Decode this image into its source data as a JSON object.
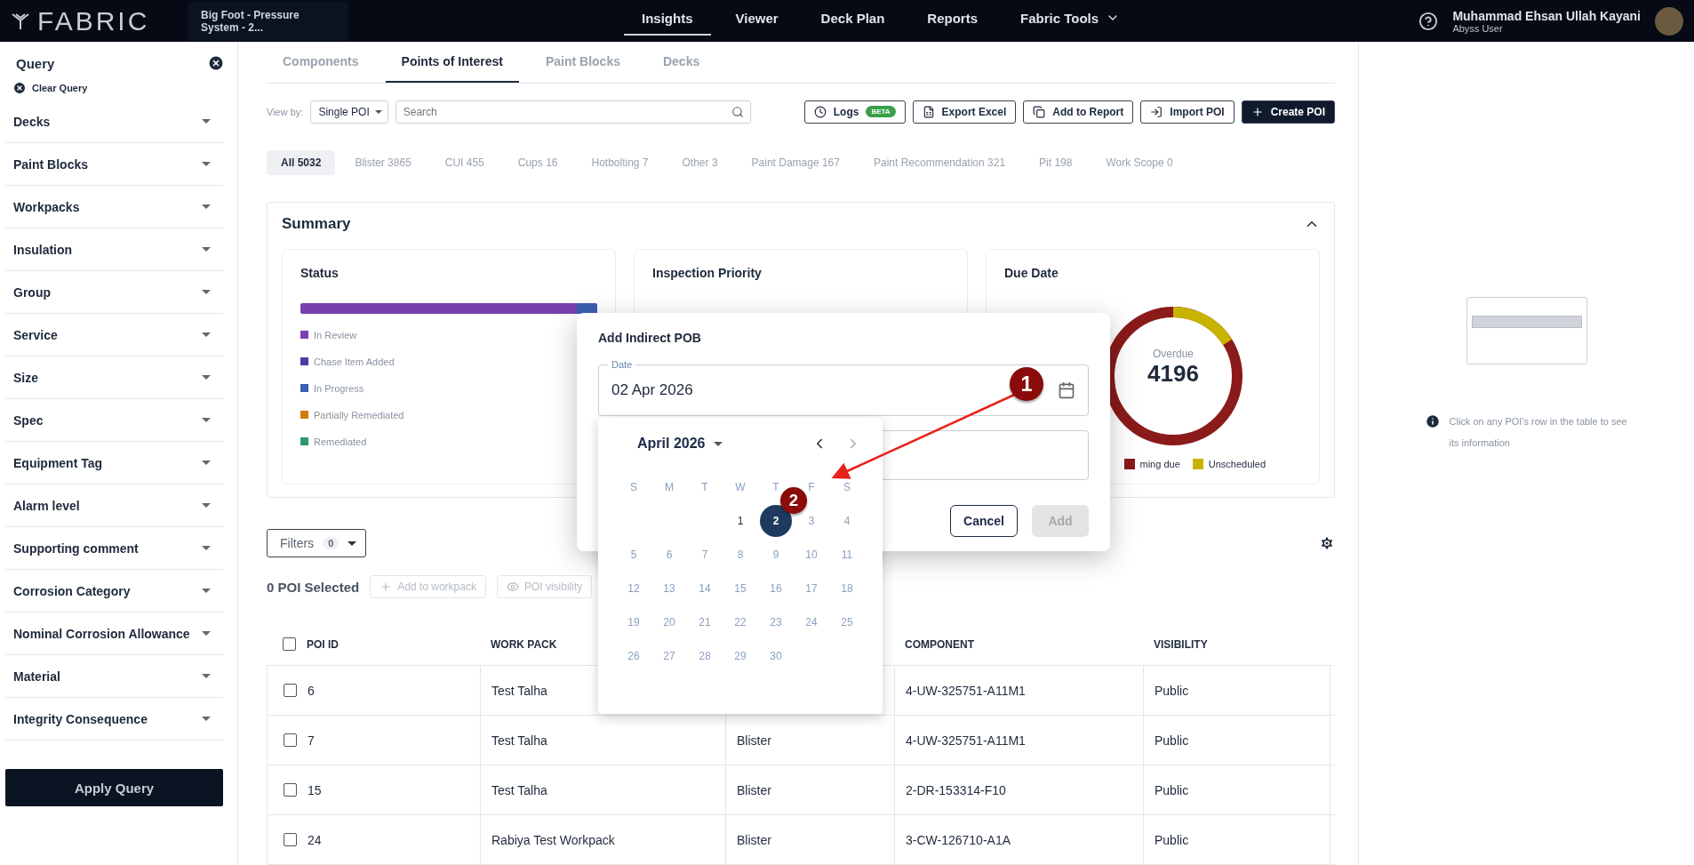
{
  "topbar": {
    "logo": "FABRIC",
    "project": "Big Foot - Pressure System - 2...",
    "nav": [
      {
        "label": "Insights",
        "selected": true,
        "kind": "link"
      },
      {
        "label": "Viewer",
        "selected": false,
        "kind": "link"
      },
      {
        "label": "Deck Plan",
        "selected": false,
        "kind": "link"
      },
      {
        "label": "Reports",
        "selected": false,
        "kind": "link"
      },
      {
        "label": "Fabric Tools",
        "selected": false,
        "kind": "menu"
      }
    ],
    "user": {
      "name": "Muhammad Ehsan Ullah Kayani",
      "role": "Abyss User"
    }
  },
  "sidebar": {
    "title": "Query",
    "clear": "Clear Query",
    "items": [
      {
        "label": "Decks"
      },
      {
        "label": "Paint Blocks"
      },
      {
        "label": "Workpacks"
      },
      {
        "label": "Insulation"
      },
      {
        "label": "Group"
      },
      {
        "label": "Service"
      },
      {
        "label": "Size"
      },
      {
        "label": "Spec"
      },
      {
        "label": "Equipment Tag"
      },
      {
        "label": "Alarm level"
      },
      {
        "label": "Supporting comment"
      },
      {
        "label": "Corrosion Category"
      },
      {
        "label": "Nominal Corrosion Allowance"
      },
      {
        "label": "Material"
      },
      {
        "label": "Integrity Consequence"
      }
    ],
    "apply": "Apply Query"
  },
  "tabs": [
    {
      "label": "Components",
      "selected": false
    },
    {
      "label": "Points of Interest",
      "selected": true
    },
    {
      "label": "Paint Blocks",
      "selected": false
    },
    {
      "label": "Decks",
      "selected": false
    }
  ],
  "toolbar": {
    "view_by_label": "View by:",
    "view_by_value": "Single POI",
    "search_placeholder": "Search",
    "buttons": [
      {
        "label": "Logs",
        "kind": "logs",
        "badge": "BETA"
      },
      {
        "label": "Export Excel",
        "kind": "excel"
      },
      {
        "label": "Add to Report",
        "kind": "report"
      },
      {
        "label": "Import POI",
        "kind": "import"
      },
      {
        "label": "Create POI",
        "kind": "create"
      }
    ]
  },
  "categories": [
    {
      "label": "All 5032",
      "selected": true
    },
    {
      "label": "Blister 3865",
      "selected": false
    },
    {
      "label": "CUI 455",
      "selected": false
    },
    {
      "label": "Cups 16",
      "selected": false
    },
    {
      "label": "Hotbolting 7",
      "selected": false
    },
    {
      "label": "Other 3",
      "selected": false
    },
    {
      "label": "Paint Damage 167",
      "selected": false
    },
    {
      "label": "Paint Recommendation 321",
      "selected": false
    },
    {
      "label": "Pit 198",
      "selected": false
    },
    {
      "label": "Work Scope 0",
      "selected": false
    }
  ],
  "summary": {
    "title": "Summary",
    "status": {
      "title": "Status",
      "legend": [
        {
          "label": "In Review",
          "color": "#7b3fb0"
        },
        {
          "label": "Chase Item Added",
          "color": "#4a3fa0"
        },
        {
          "label": "In Progress",
          "color": "#3b5fb0"
        },
        {
          "label": "Partially Remediated",
          "color": "#d07a10"
        },
        {
          "label": "Remediated",
          "color": "#2e9a6a"
        }
      ]
    },
    "priority": {
      "title": "Inspection Priority"
    },
    "due": {
      "title": "Due Date",
      "center_label": "Overdue",
      "center_value": "4196",
      "legend": [
        {
          "label": "ming due",
          "color": "#8b1a1a"
        },
        {
          "label": "Unscheduled",
          "color": "#c8b400"
        }
      ]
    }
  },
  "filters": {
    "label": "Filters",
    "count": "0"
  },
  "selection": {
    "label": "0 POI Selected",
    "actions": [
      "Add to workpack",
      "POI visibility"
    ]
  },
  "table": {
    "all_checked": false,
    "columns": [
      "POI ID",
      "WORK PACK",
      "",
      "COMPONENT",
      "VISIBILITY"
    ],
    "rows": [
      {
        "checked": false,
        "cells": [
          "6",
          "Test Talha",
          "",
          "4-UW-325751-A11M1",
          "Public"
        ]
      },
      {
        "checked": false,
        "cells": [
          "7",
          "Test Talha",
          "Blister",
          "4-UW-325751-A11M1",
          "Public"
        ]
      },
      {
        "checked": false,
        "cells": [
          "15",
          "Test Talha",
          "Blister",
          "2-DR-153314-F10",
          "Public"
        ]
      },
      {
        "checked": false,
        "cells": [
          "24",
          "Rabiya Test Workpack",
          "Blister",
          "3-CW-126710-A1A",
          "Public"
        ]
      }
    ]
  },
  "info_panel": {
    "text": "Click on any POI's row in the table to see its information"
  },
  "dialog": {
    "title": "Add Indirect POB",
    "date_label": "Date",
    "date_value": "02 Apr 2026",
    "buttons": [
      {
        "label": "Cancel",
        "kind": "secondary",
        "disabled": false
      },
      {
        "label": "Add",
        "kind": "primary",
        "disabled": true
      }
    ]
  },
  "calendar": {
    "month": "April 2026",
    "weekdays": [
      "S",
      "M",
      "T",
      "W",
      "T",
      "F",
      "S"
    ],
    "weeks": [
      [
        {
          "label": "1",
          "selected": false,
          "disabled": false
        },
        {
          "label": "2",
          "selected": true,
          "disabled": false
        },
        {
          "label": "3",
          "selected": false,
          "disabled": true
        },
        {
          "label": "4",
          "selected": false,
          "disabled": true
        }
      ],
      [
        {
          "label": "5",
          "selected": false,
          "disabled": true
        },
        {
          "label": "6",
          "selected": false,
          "disabled": true
        },
        {
          "label": "7",
          "selected": false,
          "disabled": true
        },
        {
          "label": "8",
          "selected": false,
          "disabled": true
        },
        {
          "label": "9",
          "selected": false,
          "disabled": true
        },
        {
          "label": "10",
          "selected": false,
          "disabled": true
        },
        {
          "label": "11",
          "selected": false,
          "disabled": true
        }
      ],
      [
        {
          "label": "12",
          "selected": false,
          "disabled": true
        },
        {
          "label": "13",
          "selected": false,
          "disabled": true
        },
        {
          "label": "14",
          "selected": false,
          "disabled": true
        },
        {
          "label": "15",
          "selected": false,
          "disabled": true
        },
        {
          "label": "16",
          "selected": false,
          "disabled": true
        },
        {
          "label": "17",
          "selected": false,
          "disabled": true
        },
        {
          "label": "18",
          "selected": false,
          "disabled": true
        }
      ],
      [
        {
          "label": "19",
          "selected": false,
          "disabled": true
        },
        {
          "label": "20",
          "selected": false,
          "disabled": true
        },
        {
          "label": "21",
          "selected": false,
          "disabled": true
        },
        {
          "label": "22",
          "selected": false,
          "disabled": true
        },
        {
          "label": "23",
          "selected": false,
          "disabled": true
        },
        {
          "label": "24",
          "selected": false,
          "disabled": true
        },
        {
          "label": "25",
          "selected": false,
          "disabled": true
        }
      ],
      [
        {
          "label": "26",
          "selected": false,
          "disabled": true
        },
        {
          "label": "27",
          "selected": false,
          "disabled": true
        },
        {
          "label": "28",
          "selected": false,
          "disabled": true
        },
        {
          "label": "29",
          "selected": false,
          "disabled": true
        },
        {
          "label": "30",
          "selected": false,
          "disabled": true
        }
      ]
    ]
  },
  "annotations": [
    {
      "label": "1"
    },
    {
      "label": "2"
    }
  ]
}
